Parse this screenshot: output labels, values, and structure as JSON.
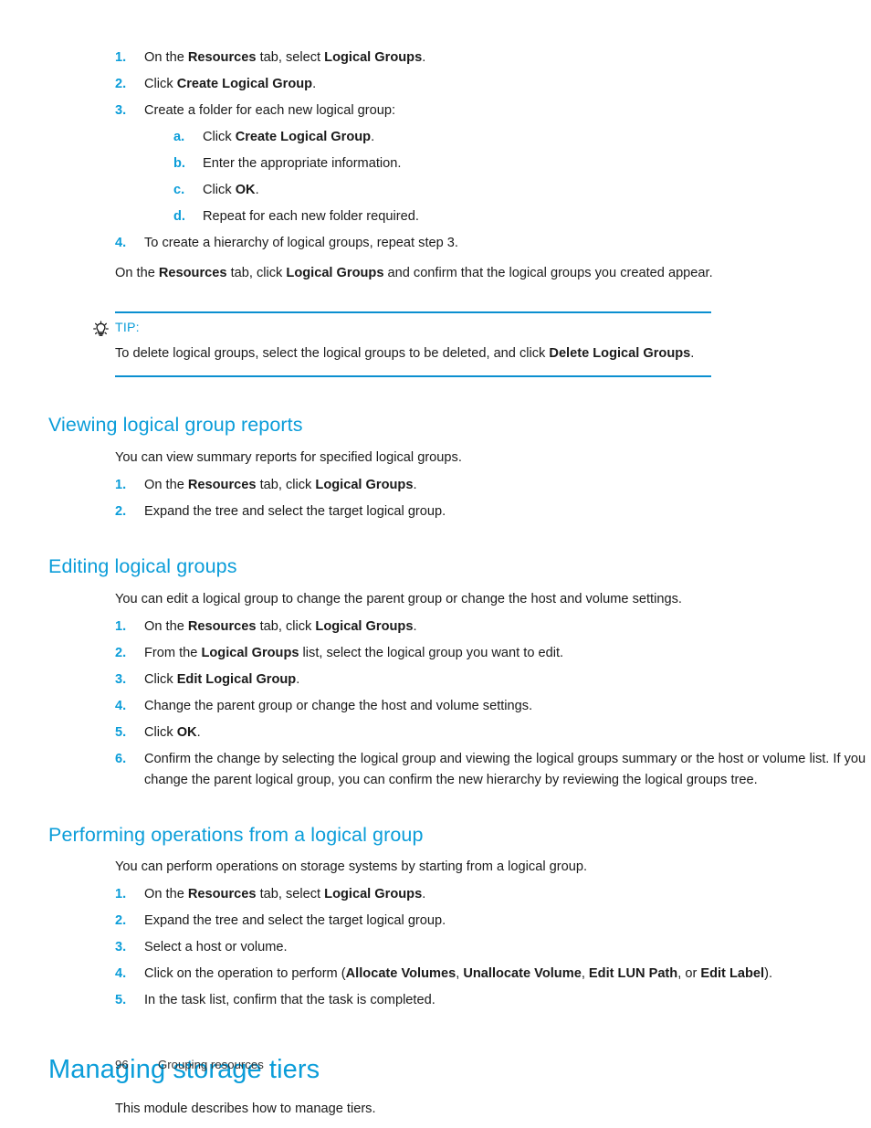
{
  "colors": {
    "accent_blue": "#0b9dd9",
    "rule_blue": "#0b8fd0",
    "body_text": "#1a1a1a",
    "footer_text": "#333333",
    "page_background": "#ffffff"
  },
  "top_procedure": {
    "steps": [
      {
        "marker": "1.",
        "runs": [
          {
            "t": "On the ",
            "b": false
          },
          {
            "t": "Resources",
            "b": true
          },
          {
            "t": " tab, select ",
            "b": false
          },
          {
            "t": "Logical Groups",
            "b": true
          },
          {
            "t": ".",
            "b": false
          }
        ]
      },
      {
        "marker": "2.",
        "runs": [
          {
            "t": "Click ",
            "b": false
          },
          {
            "t": "Create Logical Group",
            "b": true
          },
          {
            "t": ".",
            "b": false
          }
        ]
      },
      {
        "marker": "3.",
        "runs": [
          {
            "t": "Create a folder for each new logical group:",
            "b": false
          }
        ],
        "substeps": [
          {
            "marker": "a.",
            "runs": [
              {
                "t": "Click ",
                "b": false
              },
              {
                "t": "Create Logical Group",
                "b": true
              },
              {
                "t": ".",
                "b": false
              }
            ]
          },
          {
            "marker": "b.",
            "runs": [
              {
                "t": "Enter the appropriate information.",
                "b": false
              }
            ]
          },
          {
            "marker": "c.",
            "runs": [
              {
                "t": "Click ",
                "b": false
              },
              {
                "t": "OK",
                "b": true
              },
              {
                "t": ".",
                "b": false
              }
            ]
          },
          {
            "marker": "d.",
            "runs": [
              {
                "t": "Repeat for each new folder required.",
                "b": false
              }
            ]
          }
        ]
      },
      {
        "marker": "4.",
        "runs": [
          {
            "t": "To create a hierarchy of logical groups, repeat step 3.",
            "b": false
          }
        ]
      }
    ],
    "closing_paragraph": [
      {
        "t": "On the ",
        "b": false
      },
      {
        "t": "Resources",
        "b": true
      },
      {
        "t": " tab, click ",
        "b": false
      },
      {
        "t": "Logical Groups",
        "b": true
      },
      {
        "t": " and confirm that the logical groups you created appear.",
        "b": false
      }
    ]
  },
  "tip": {
    "icon": "lightbulb-icon",
    "label": "TIP:",
    "body": [
      {
        "t": "To delete logical groups, select the logical groups to be deleted, and click ",
        "b": false
      },
      {
        "t": "Delete Logical Groups",
        "b": true
      },
      {
        "t": ".",
        "b": false
      }
    ]
  },
  "sections": [
    {
      "heading": "Viewing logical group reports",
      "intro": [
        {
          "t": "You can view summary reports for specified logical groups.",
          "b": false
        }
      ],
      "steps": [
        {
          "marker": "1.",
          "runs": [
            {
              "t": "On the ",
              "b": false
            },
            {
              "t": "Resources",
              "b": true
            },
            {
              "t": " tab, click ",
              "b": false
            },
            {
              "t": "Logical Groups",
              "b": true
            },
            {
              "t": ".",
              "b": false
            }
          ]
        },
        {
          "marker": "2.",
          "runs": [
            {
              "t": "Expand the tree and select the target logical group.",
              "b": false
            }
          ]
        }
      ]
    },
    {
      "heading": "Editing logical groups",
      "intro": [
        {
          "t": "You can edit a logical group to change the parent group or change the host and volume settings.",
          "b": false
        }
      ],
      "steps": [
        {
          "marker": "1.",
          "runs": [
            {
              "t": "On the ",
              "b": false
            },
            {
              "t": "Resources",
              "b": true
            },
            {
              "t": " tab, click ",
              "b": false
            },
            {
              "t": "Logical Groups",
              "b": true
            },
            {
              "t": ".",
              "b": false
            }
          ]
        },
        {
          "marker": "2.",
          "runs": [
            {
              "t": "From the  ",
              "b": false
            },
            {
              "t": "Logical Groups",
              "b": true
            },
            {
              "t": " list, select the logical group you want to edit.",
              "b": false
            }
          ]
        },
        {
          "marker": "3.",
          "runs": [
            {
              "t": "Click ",
              "b": false
            },
            {
              "t": "Edit Logical Group",
              "b": true
            },
            {
              "t": ".",
              "b": false
            }
          ]
        },
        {
          "marker": "4.",
          "runs": [
            {
              "t": "Change the parent group or change the host and volume settings.",
              "b": false
            }
          ]
        },
        {
          "marker": "5.",
          "runs": [
            {
              "t": "Click ",
              "b": false
            },
            {
              "t": "OK",
              "b": true
            },
            {
              "t": ".",
              "b": false
            }
          ]
        },
        {
          "marker": "6.",
          "runs": [
            {
              "t": "Confirm the change by selecting the logical group and viewing the logical groups summary or the host or volume list. If you change the parent logical group, you can confirm the new hierarchy by reviewing the logical groups tree.",
              "b": false
            }
          ]
        }
      ]
    },
    {
      "heading": "Performing operations from a logical group",
      "intro": [
        {
          "t": "You can perform operations on storage systems by starting from a logical group.",
          "b": false
        }
      ],
      "steps": [
        {
          "marker": "1.",
          "runs": [
            {
              "t": "On the ",
              "b": false
            },
            {
              "t": "Resources",
              "b": true
            },
            {
              "t": " tab, select ",
              "b": false
            },
            {
              "t": "Logical Groups",
              "b": true
            },
            {
              "t": ".",
              "b": false
            }
          ]
        },
        {
          "marker": "2.",
          "runs": [
            {
              "t": "Expand the tree and select the target logical group.",
              "b": false
            }
          ]
        },
        {
          "marker": "3.",
          "runs": [
            {
              "t": "Select a host or volume.",
              "b": false
            }
          ]
        },
        {
          "marker": "4.",
          "runs": [
            {
              "t": "Click on the operation to perform (",
              "b": false
            },
            {
              "t": "Allocate Volumes",
              "b": true
            },
            {
              "t": ", ",
              "b": false
            },
            {
              "t": "Unallocate Volume",
              "b": true
            },
            {
              "t": ", ",
              "b": false
            },
            {
              "t": "Edit LUN Path",
              "b": true
            },
            {
              "t": ", or ",
              "b": false
            },
            {
              "t": "Edit Label",
              "b": true
            },
            {
              "t": ").",
              "b": false
            }
          ]
        },
        {
          "marker": "5.",
          "runs": [
            {
              "t": "In the task list, confirm that the task is completed.",
              "b": false
            }
          ]
        }
      ]
    }
  ],
  "chapter": {
    "heading": "Managing storage tiers",
    "intro": [
      {
        "t": "This module describes how to manage tiers.",
        "b": false
      }
    ]
  },
  "footer": {
    "page_number": "96",
    "chapter_name": "Grouping resources"
  }
}
